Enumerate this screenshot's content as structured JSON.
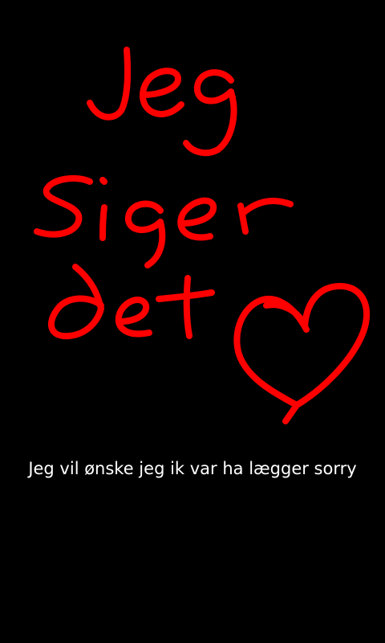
{
  "snap": {
    "background_color": "#000000",
    "drawing": {
      "color": "#ff0000",
      "handwritten_lines": [
        "jeg",
        "siger",
        "det"
      ],
      "symbol": "heart"
    },
    "caption": {
      "text": "Jeg vil ønske jeg ik var ha lægger sorry",
      "color": "#ffffff"
    }
  }
}
